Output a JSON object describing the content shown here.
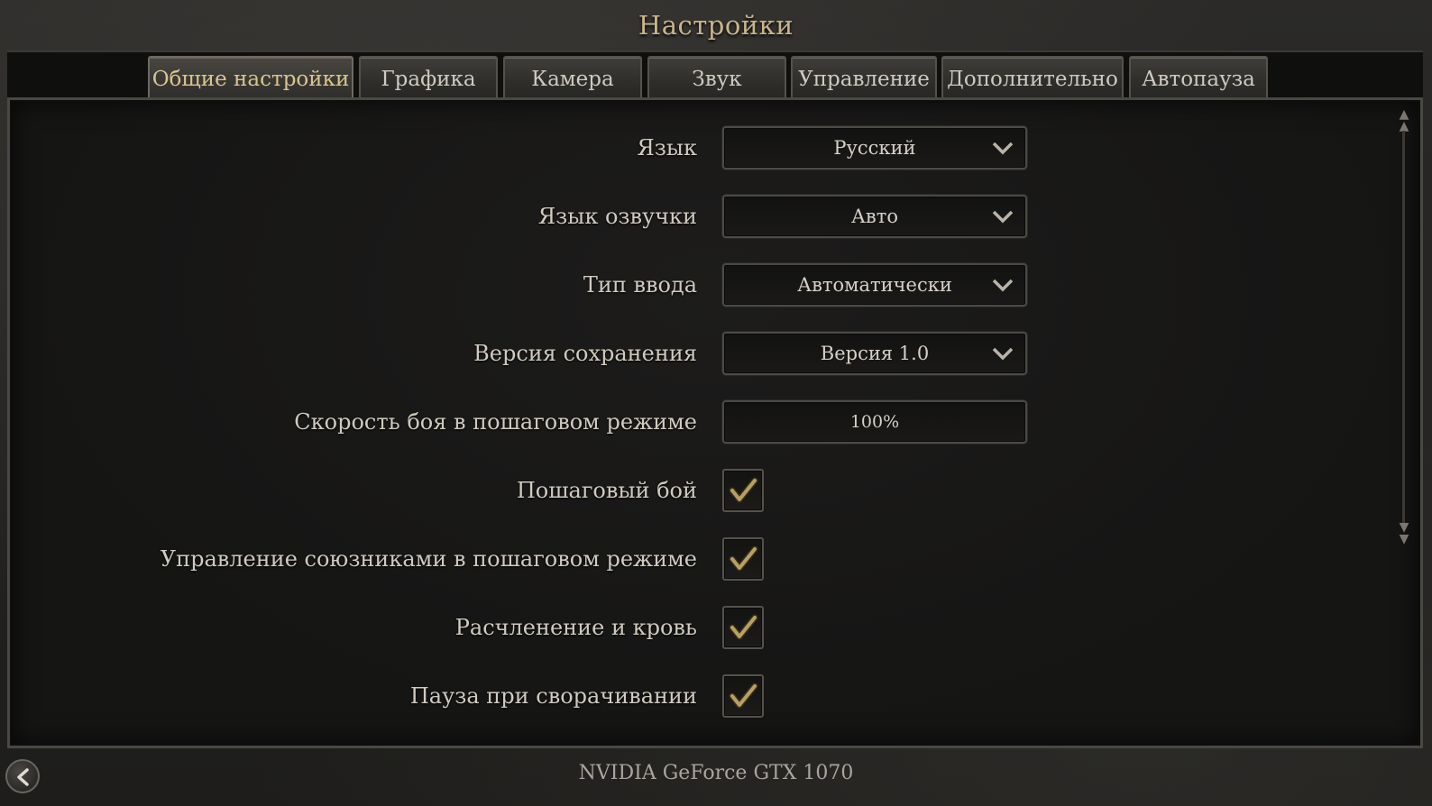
{
  "window": {
    "title": "Настройки"
  },
  "tabs": [
    {
      "label": "Общие настройки",
      "active": true
    },
    {
      "label": "Графика",
      "active": false
    },
    {
      "label": "Камера",
      "active": false
    },
    {
      "label": "Звук",
      "active": false
    },
    {
      "label": "Управление",
      "active": false
    },
    {
      "label": "Дополнительно",
      "active": false
    },
    {
      "label": "Автопауза",
      "active": false
    }
  ],
  "settings": {
    "language": {
      "label": "Язык",
      "value": "Русский",
      "icon": "chevron-down-icon"
    },
    "voice_language": {
      "label": "Язык озвучки",
      "value": "Авто",
      "icon": "chevron-down-icon"
    },
    "input_type": {
      "label": "Тип ввода",
      "value": "Автоматически",
      "icon": "chevron-down-icon"
    },
    "save_version": {
      "label": "Версия сохранения",
      "value": "Версия 1.0",
      "icon": "chevron-down-icon"
    },
    "turn_based_speed": {
      "label": "Скорость боя в пошаговом режиме",
      "value": "100%"
    },
    "turn_based_combat": {
      "label": "Пошаговый бой",
      "checked": true
    },
    "ally_control": {
      "label": "Управление союзниками в пошаговом режиме",
      "checked": true
    },
    "gore": {
      "label": "Расчленение и кровь",
      "checked": true
    },
    "pause_on_minimize": {
      "label": "Пауза при сворачивании",
      "checked": true
    }
  },
  "footer": {
    "gpu": "NVIDIA GeForce GTX 1070",
    "back_icon": "back-arrow-icon"
  },
  "colors": {
    "accent": "#d9c58f",
    "text": "#d0cabf",
    "check": "#b8a065",
    "border": "#4c4a45"
  }
}
